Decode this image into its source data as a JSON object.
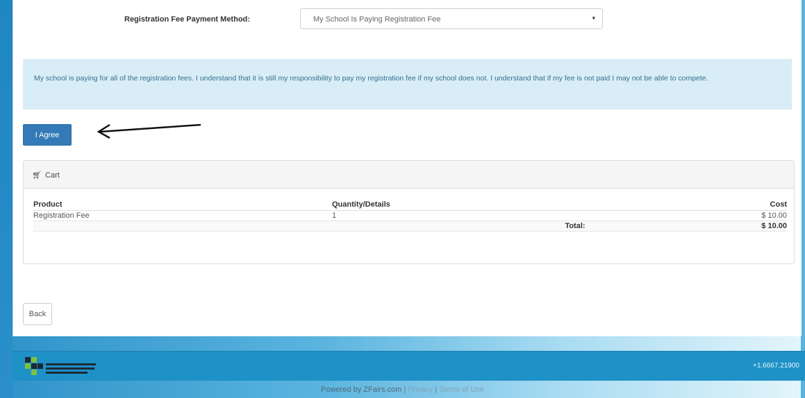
{
  "payment": {
    "label": "Registration Fee Payment Method:",
    "selected": "My School Is Paying Registration Fee"
  },
  "notice": "My school is paying for all of the registration fees. I understand that it is still my responsibility to pay my registration fee if my school does not. I understand that if my fee is not paid I may not be able to compete.",
  "agree_label": "I Agree",
  "cart": {
    "title": "Cart",
    "headers": {
      "product": "Product",
      "quantity": "Quantity/Details",
      "cost": "Cost"
    },
    "rows": [
      {
        "product": "Registration Fee",
        "quantity": "1",
        "cost": "$ 10.00"
      }
    ],
    "total_label": "Total:",
    "total_value": "$ 10.00"
  },
  "back_label": "Back",
  "footer": {
    "phone": "+1.6667.21900",
    "powered_by": "Powered by",
    "site": "ZFairs.com",
    "sep1": "|",
    "privacy": "Privacy",
    "sep2": "|",
    "terms": "Terms of Use"
  },
  "colors": {
    "primary": "#337ab7",
    "info_bg": "#d9edf7",
    "footer_bar": "#1e91c7"
  }
}
